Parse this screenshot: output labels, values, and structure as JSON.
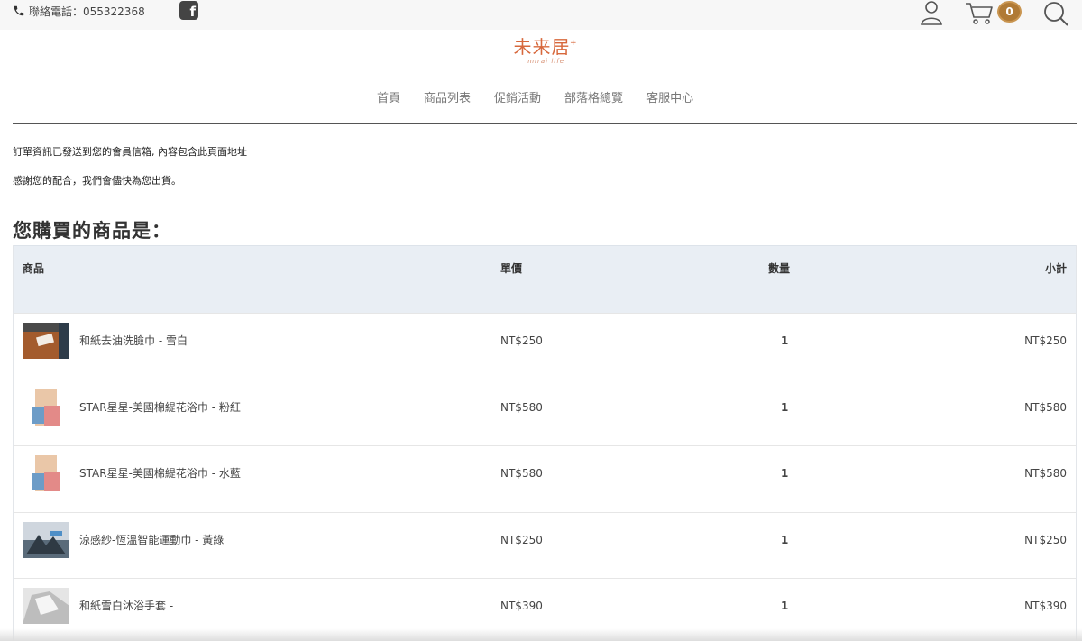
{
  "topbar": {
    "contact": "聯絡電話：055322368",
    "facebook": "f",
    "cart_count": "0"
  },
  "logo": {
    "name": "未来居",
    "plus": "+",
    "sub": "mirai life"
  },
  "nav": [
    "首頁",
    "商品列表",
    "促銷活動",
    "部落格總覽",
    "客服中心"
  ],
  "messages": {
    "line1": "訂單資訊已發送到您的會員信箱, 內容包含此頁面地址",
    "line2": "感謝您的配合，我們會儘快為您出貨。"
  },
  "heading": "您購買的商品是：",
  "table": {
    "headers": {
      "product": "商品",
      "price": "單價",
      "qty": "數量",
      "subtotal": "小計"
    },
    "rows": [
      {
        "name": "和紙去油洗臉巾 - 雪白",
        "price": "NT$250",
        "qty": "1",
        "subtotal": "NT$250"
      },
      {
        "name": "STAR星星-美國棉緹花浴巾 - 粉紅",
        "price": "NT$580",
        "qty": "1",
        "subtotal": "NT$580"
      },
      {
        "name": "STAR星星-美國棉緹花浴巾 - 水藍",
        "price": "NT$580",
        "qty": "1",
        "subtotal": "NT$580"
      },
      {
        "name": "涼感紗-恆溫智能運動巾 - 黃綠",
        "price": "NT$250",
        "qty": "1",
        "subtotal": "NT$250"
      },
      {
        "name": "和紙雪白沐浴手套 -",
        "price": "NT$390",
        "qty": "1",
        "subtotal": "NT$390"
      }
    ]
  },
  "colors": {
    "accent": "#d7683c",
    "badge": "#b07a35",
    "header_bg": "#e9eef4"
  }
}
